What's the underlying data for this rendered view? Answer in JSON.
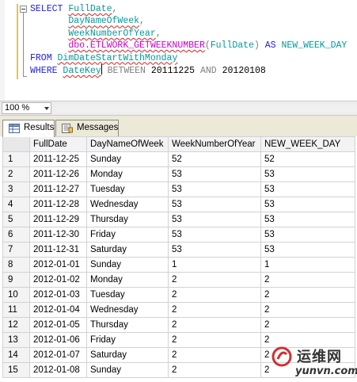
{
  "editor": {
    "line1_kw": "SELECT",
    "line1_col": "FullDate",
    "line2_col": "DayNameOfWeek",
    "line3_col": "WeekNumberOfYear",
    "line4_fn": "dbo.ETLWORK_GETWEEKNUMBER",
    "line4_arg": "FullDate",
    "line4_as": "AS",
    "line4_alias": "NEW_WEEK_DAY",
    "line5_kw": "FROM",
    "line5_table": "DimDateStartWithMonday",
    "line6_kw": "WHERE",
    "line6_col": "DateKey",
    "line6_between": "BETWEEN",
    "line6_from": "20111225",
    "line6_and": "AND",
    "line6_to": "20120108"
  },
  "zoom": {
    "value": "100 %"
  },
  "tabs": [
    {
      "label": "Results",
      "icon": "grid-icon",
      "active": true
    },
    {
      "label": "Messages",
      "icon": "messages-icon",
      "active": false
    }
  ],
  "grid": {
    "columns": [
      "FullDate",
      "DayNameOfWeek",
      "WeekNumberOfYear",
      "NEW_WEEK_DAY"
    ],
    "rows": [
      [
        "1",
        "2011-12-25",
        "Sunday",
        "52",
        "52"
      ],
      [
        "2",
        "2011-12-26",
        "Monday",
        "53",
        "53"
      ],
      [
        "3",
        "2011-12-27",
        "Tuesday",
        "53",
        "53"
      ],
      [
        "4",
        "2011-12-28",
        "Wednesday",
        "53",
        "53"
      ],
      [
        "5",
        "2011-12-29",
        "Thursday",
        "53",
        "53"
      ],
      [
        "6",
        "2011-12-30",
        "Friday",
        "53",
        "53"
      ],
      [
        "7",
        "2011-12-31",
        "Saturday",
        "53",
        "53"
      ],
      [
        "8",
        "2012-01-01",
        "Sunday",
        "1",
        "1"
      ],
      [
        "9",
        "2012-01-02",
        "Monday",
        "2",
        "2"
      ],
      [
        "10",
        "2012-01-03",
        "Tuesday",
        "2",
        "2"
      ],
      [
        "11",
        "2012-01-04",
        "Wednesday",
        "2",
        "2"
      ],
      [
        "12",
        "2012-01-05",
        "Thursday",
        "2",
        "2"
      ],
      [
        "13",
        "2012-01-06",
        "Friday",
        "2",
        "2"
      ],
      [
        "14",
        "2012-01-07",
        "Saturday",
        "2",
        "2"
      ],
      [
        "15",
        "2012-01-08",
        "Sunday",
        "2",
        "2"
      ]
    ]
  },
  "watermark": {
    "text_cn": "运维网",
    "url": "yunvn.com"
  },
  "colors": {
    "keyword": "#1f1fd6",
    "function": "#cc00cc",
    "identifier": "#009a9a",
    "operator": "#808080"
  }
}
